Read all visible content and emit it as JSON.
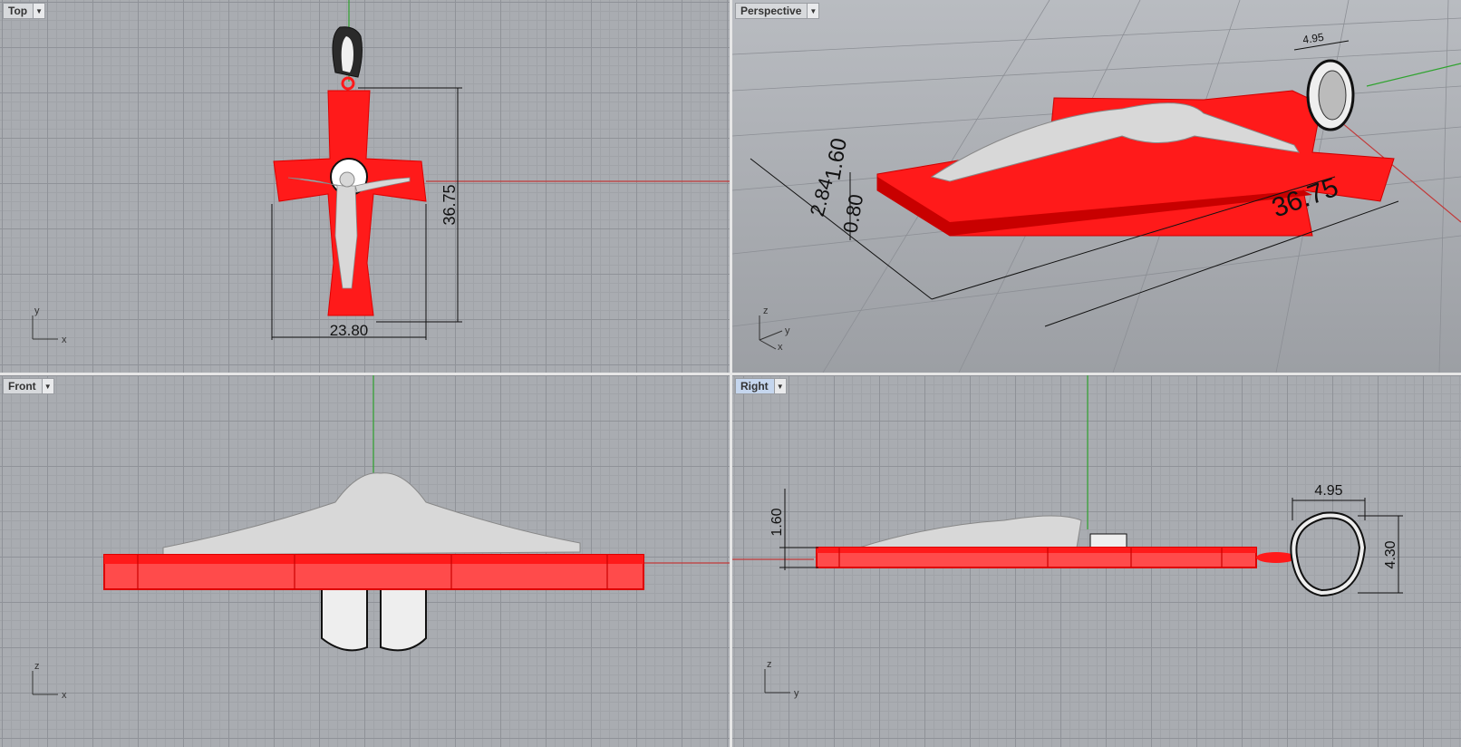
{
  "viewports": {
    "top": {
      "label": "Top",
      "dims": {
        "height": "36.75",
        "width": "23.80"
      },
      "axes": {
        "a": "y",
        "b": "x"
      }
    },
    "perspective": {
      "label": "Perspective",
      "dims": {
        "length": "36.75",
        "thickness": "1.60",
        "depth_a": "0.80",
        "depth_b": "2.84",
        "bail": "4.95"
      },
      "axes": {
        "a": "z",
        "b": "y",
        "c": "x"
      }
    },
    "front": {
      "label": "Front",
      "axes": {
        "a": "z",
        "b": "x"
      }
    },
    "right": {
      "label": "Right",
      "active": true,
      "dims": {
        "thickness": "1.60",
        "bail_width": "4.95",
        "bail_height": "4.30"
      },
      "axes": {
        "a": "z",
        "b": "y"
      }
    }
  },
  "icons": {
    "viewport_menu": "dropdown-arrow-icon"
  },
  "colors": {
    "model": "#ff1a1a",
    "figure": "#d8d8d8",
    "x_axis": "#c23a3a",
    "y_axis": "#2fa32f"
  }
}
